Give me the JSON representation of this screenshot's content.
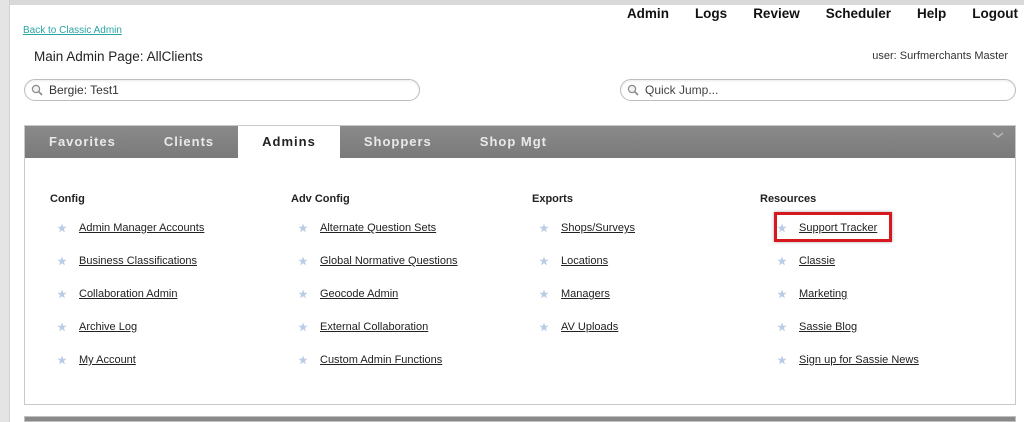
{
  "header": {
    "back_link": "Back to Classic Admin",
    "nav": [
      "Admin",
      "Logs",
      "Review",
      "Scheduler",
      "Help",
      "Logout"
    ],
    "page_title": "Main Admin Page: AllClients",
    "user_label": "user: Surfmerchants Master"
  },
  "search": {
    "client_value": "Bergie: Test1",
    "quick_jump_placeholder": "Quick Jump..."
  },
  "tabs": [
    "Favorites",
    "Clients",
    "Admins",
    "Shoppers",
    "Shop Mgt"
  ],
  "active_tab": "Admins",
  "columns": [
    {
      "title": "Config",
      "items": [
        "Admin Manager Accounts",
        "Business Classifications",
        "Collaboration Admin",
        "Archive Log",
        "My Account"
      ]
    },
    {
      "title": "Adv Config",
      "items": [
        "Alternate Question Sets",
        "Global Normative Questions",
        "Geocode Admin",
        "External Collaboration",
        "Custom Admin Functions"
      ]
    },
    {
      "title": "Exports",
      "items": [
        "Shops/Surveys",
        "Locations",
        "Managers",
        "AV Uploads"
      ]
    },
    {
      "title": "Resources",
      "items": [
        "Support Tracker",
        "Classie",
        "Marketing",
        "Sassie Blog",
        "Sign up for Sassie News"
      ]
    }
  ],
  "highlighted_item": "Support Tracker",
  "colors": {
    "highlight": "#d6191f",
    "tabbar": "#808080",
    "star": "#b9cde6",
    "link_teal": "#2aa3a3"
  },
  "icons": {
    "search": "magnifier-icon",
    "item": "star-icon",
    "collapse": "chevron-down-icon"
  }
}
